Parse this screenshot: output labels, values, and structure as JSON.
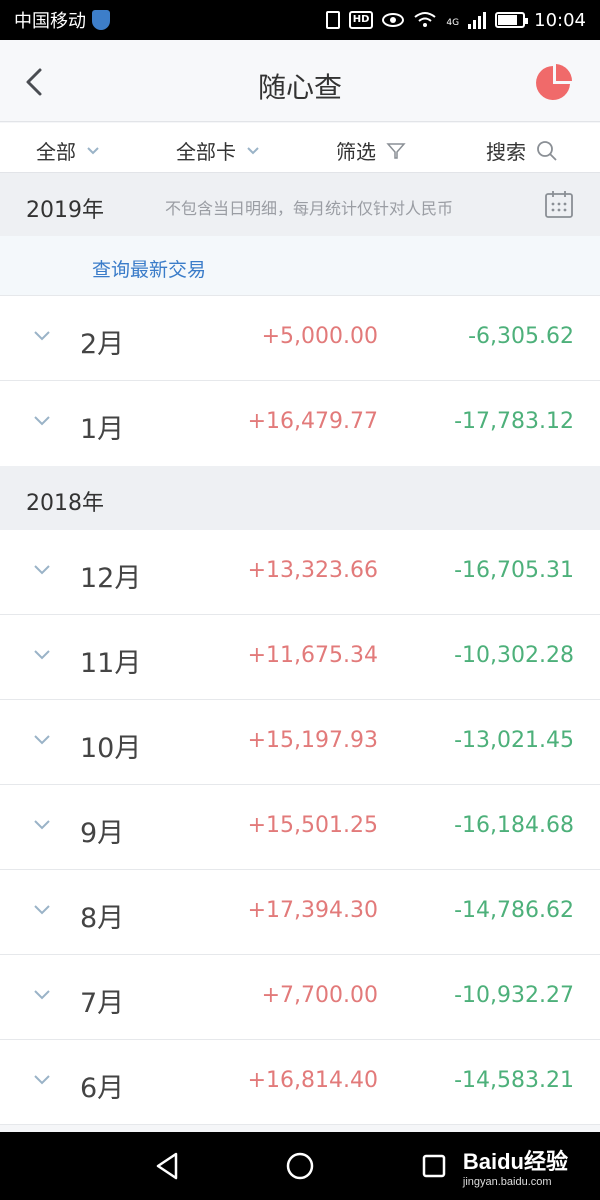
{
  "status_bar": {
    "carrier": "中国移动",
    "network": "4G",
    "time": "10:04"
  },
  "header": {
    "title": "随心查",
    "back_icon": "chevron-left-icon",
    "chart_icon": "pie-chart-icon"
  },
  "filters": {
    "all_label": "全部",
    "all_cards_label": "全部卡",
    "filter_label": "筛选",
    "search_label": "搜索"
  },
  "sections": [
    {
      "year": "2019年",
      "note": "不包含当日明细，每月统计仅针对人民币",
      "query_link": "查询最新交易",
      "months": [
        {
          "month": "2月",
          "income": "+5,000.00",
          "expense": "-6,305.62"
        },
        {
          "month": "1月",
          "income": "+16,479.77",
          "expense": "-17,783.12"
        }
      ]
    },
    {
      "year": "2018年",
      "months": [
        {
          "month": "12月",
          "income": "+13,323.66",
          "expense": "-16,705.31"
        },
        {
          "month": "11月",
          "income": "+11,675.34",
          "expense": "-10,302.28"
        },
        {
          "month": "10月",
          "income": "+15,197.93",
          "expense": "-13,021.45"
        },
        {
          "month": "9月",
          "income": "+15,501.25",
          "expense": "-16,184.68"
        },
        {
          "month": "8月",
          "income": "+17,394.30",
          "expense": "-14,786.62"
        },
        {
          "month": "7月",
          "income": "+7,700.00",
          "expense": "-10,932.27"
        },
        {
          "month": "6月",
          "income": "+16,814.40",
          "expense": "-14,583.21"
        }
      ]
    }
  ],
  "watermark": {
    "brand": "Baidu经验",
    "url": "jingyan.baidu.com"
  },
  "colors": {
    "income": "#e27a7a",
    "expense": "#4db07a",
    "link": "#3a7cc9",
    "pie_accent": "#f06a6a"
  }
}
